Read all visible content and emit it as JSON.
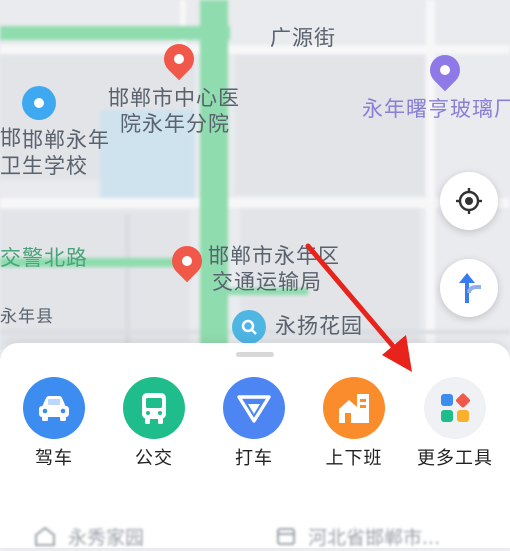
{
  "map": {
    "labels": [
      {
        "text": "广源街",
        "style": "dark"
      },
      {
        "text": "邯郸市中心医",
        "style": "dark"
      },
      {
        "text": "院永年分院",
        "style": "dark"
      },
      {
        "text": "永年曙亨玻璃厂",
        "style": "purple"
      },
      {
        "text": "邯",
        "style": "dark"
      },
      {
        "text": "邯郸永年",
        "style": "dark"
      },
      {
        "text": "卫生学校",
        "style": "dark"
      },
      {
        "text": "交警北路",
        "style": "green"
      },
      {
        "text": "邯郸市永年区",
        "style": "dark"
      },
      {
        "text": "交通运输局",
        "style": "dark"
      },
      {
        "text": "永年县",
        "style": "dark"
      },
      {
        "text": "永扬花园",
        "style": "dark"
      }
    ],
    "buttons": {
      "locate": "locate-icon",
      "navigate": "route-arrow-icon"
    }
  },
  "tools": [
    {
      "label": "驾车",
      "icon": "car-icon",
      "color": "#3d8cf0"
    },
    {
      "label": "公交",
      "icon": "bus-icon",
      "color": "#1fbd8c"
    },
    {
      "label": "打车",
      "icon": "taxi-icon",
      "color": "#4d86f2"
    },
    {
      "label": "上下班",
      "icon": "commute-icon",
      "color": "#fb8c2b"
    },
    {
      "label": "更多工具",
      "icon": "more-tools-icon",
      "color": "#f0f1f4"
    }
  ],
  "recent": [
    {
      "text": "永秀家园",
      "icon": "home-icon"
    },
    {
      "text": "河北省邯郸市...",
      "icon": "calendar-icon"
    }
  ],
  "annotation": {
    "color": "#e8231c"
  }
}
